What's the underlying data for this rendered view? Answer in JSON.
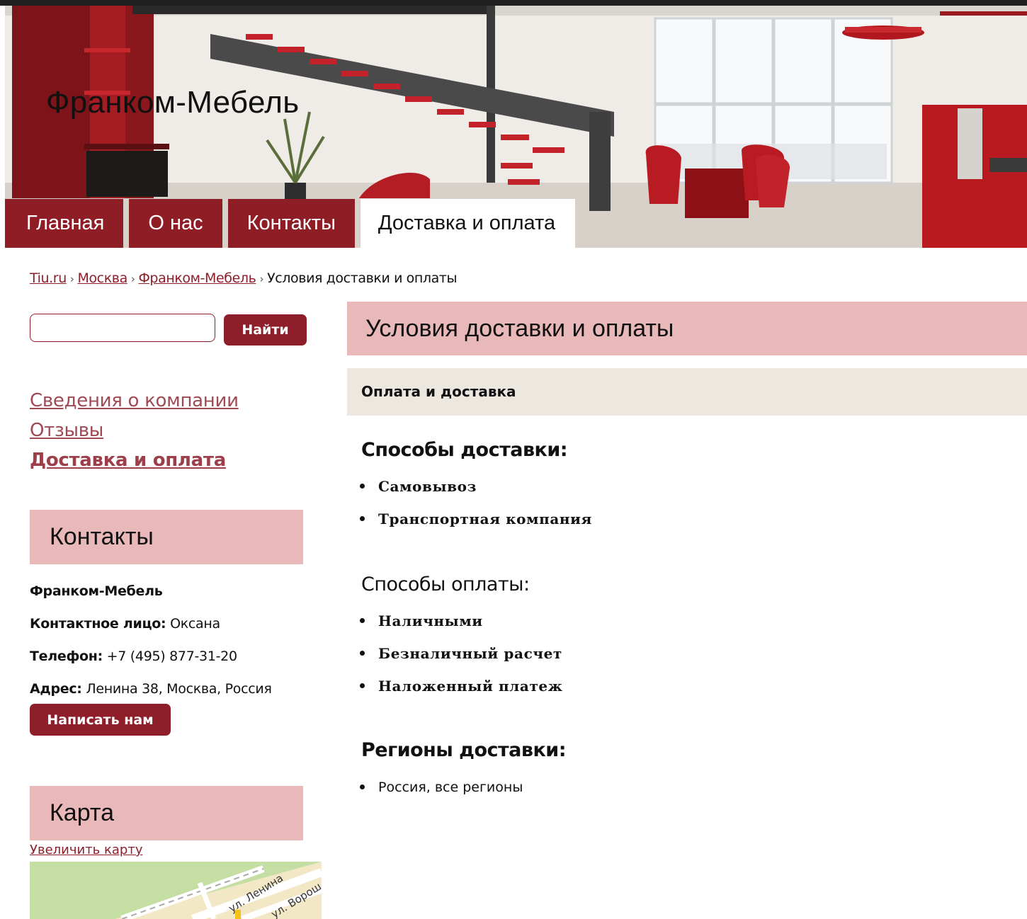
{
  "header": {
    "site_title": "Франком-Мебель",
    "nav": [
      {
        "label": "Главная",
        "active": false
      },
      {
        "label": "О нас",
        "active": false
      },
      {
        "label": "Контакты",
        "active": false
      },
      {
        "label": "Доставка и оплата",
        "active": true
      }
    ]
  },
  "breadcrumb": {
    "items": [
      "Tiu.ru",
      "Москва",
      "Франком-Мебель"
    ],
    "current": "Условия доставки и оплаты",
    "separator": "›"
  },
  "search": {
    "value": "",
    "button_label": "Найти"
  },
  "side_menu": {
    "items": [
      {
        "label": "Сведения о компании",
        "current": false
      },
      {
        "label": "Отзывы",
        "current": false
      },
      {
        "label": "Доставка и оплата",
        "current": true
      }
    ]
  },
  "contacts": {
    "heading": "Контакты",
    "company": "Франком-Мебель",
    "person_label": "Контактное лицо:",
    "person": "Оксана",
    "phone_label": "Телефон:",
    "phone": "+7 (495) 877-31-20",
    "address_label": "Адрес:",
    "address": "Ленина 38, Москва, Россия",
    "write_button": "Написать нам"
  },
  "map": {
    "heading": "Карта",
    "enlarge_link": "Увеличить карту",
    "street_labels": [
      "ул. Ленина",
      "ул. Ворош"
    ]
  },
  "main": {
    "title": "Условия доставки и оплаты",
    "subtitle": "Оплата и доставка",
    "sections": [
      {
        "title": "Способы доставки:",
        "items": [
          "Самовывоз",
          "Транспортная компания"
        ]
      },
      {
        "title": "Способы оплаты:",
        "items": [
          "Наличными",
          "Безналичный расчет",
          "Наложенный платеж"
        ]
      },
      {
        "title": "Регионы доставки:",
        "items": [
          "Россия, все регионы"
        ]
      }
    ]
  },
  "colors": {
    "brand": "#8e1f2a",
    "heading_bg": "#e9b9ba",
    "subheading_bg": "#ece8e0"
  }
}
